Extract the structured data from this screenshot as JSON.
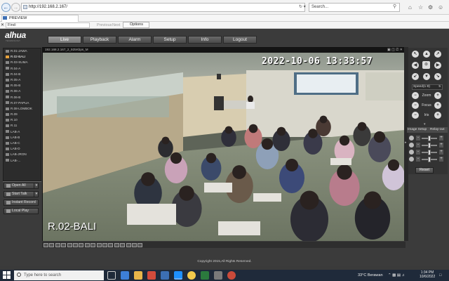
{
  "browser": {
    "url": "http://192.168.2.167/",
    "search_placeholder": "Search...",
    "tab_title": "PREVIEW",
    "find_label": "Find:",
    "find_prev": "Previous",
    "find_next": "Next",
    "options_label": "Options"
  },
  "app": {
    "logo": "alhua",
    "logo_sub": "TECHNOLOGY",
    "nav": [
      "Live",
      "Playback",
      "Alarm",
      "Setup",
      "Info",
      "Logout"
    ],
    "active_nav": "Live",
    "channels": [
      "R.01-JAWA",
      "R.02-BALI",
      "R.03-SUMA",
      "R.04-A",
      "R.04-B",
      "R.05-A",
      "R.05-B",
      "R.06-A",
      "R.06-B",
      "R.07-PAPUA",
      "R.08-LOMBOK",
      "R.09",
      "R.10",
      "R.11",
      "LAB-A",
      "LAB-B",
      "LAB-C",
      "LAB-D",
      "LAB-JRON",
      "LAB-..."
    ],
    "active_channel": "R.02-BALI",
    "left_buttons": [
      "Open All",
      "Start Talk",
      "Instant Record",
      "Local Play"
    ],
    "video_info": "192.168.2.167_2_925Kbps_M",
    "video_timestamp": "2022-10-06 13:33:57",
    "video_camera_name": "R.02-BALI",
    "copyright": "Copyright 2015,All Rights Reserved."
  },
  "ptz": {
    "speed_label": "Speed(1-8)",
    "speed_value": "5",
    "zoom_label": "Zoom",
    "focus_label": "Focus",
    "iris_label": "Iris",
    "image_setup_label": "Image Setup",
    "relay_out_label": "Relay-out",
    "reset_label": "Reset",
    "sliders": [
      0.5,
      0.5,
      0.5,
      0.5
    ]
  },
  "taskbar": {
    "search_placeholder": "Type here to search",
    "weather": "33°C  Berawan",
    "time": "1:34 PM",
    "date": "10/6/2022"
  }
}
